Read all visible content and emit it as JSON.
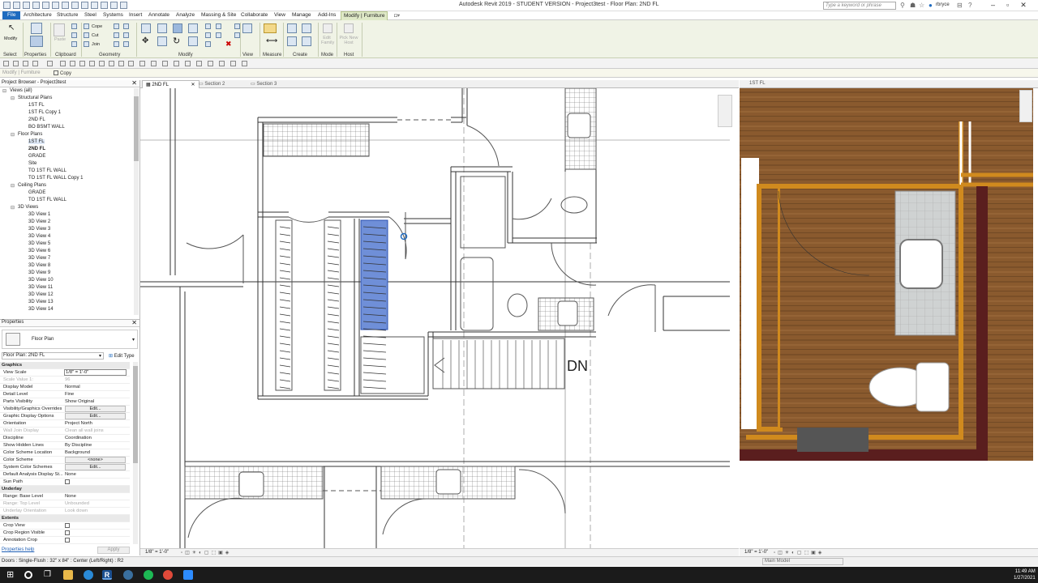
{
  "window": {
    "title": "Autodesk Revit 2019 - STUDENT VERSION - Project3test - Floor Plan: 2ND FL",
    "search_placeholder": "Type a keyword or phrase",
    "user": "rbryce"
  },
  "menu": {
    "tabs": [
      "File",
      "Architecture",
      "Structure",
      "Steel",
      "Systems",
      "Insert",
      "Annotate",
      "Analyze",
      "Massing & Site",
      "Collaborate",
      "View",
      "Manage",
      "Add-Ins",
      "Modify | Furniture"
    ]
  },
  "ribbon": {
    "modify": "Modify",
    "properties": "Properties",
    "paste": "Paste",
    "cope": "Cope",
    "cut": "Cut",
    "join": "Join",
    "edit_family": "Edit Family",
    "pick_new_host": "Pick New Host",
    "panels": [
      "Select",
      "Properties",
      "Clipboard",
      "Geometry",
      "Modify",
      "View",
      "Measure",
      "Create",
      "Mode",
      "Host"
    ]
  },
  "context": {
    "label": "Modify | Furniture",
    "copy_label": "Copy"
  },
  "project_browser": {
    "title": "Project Browser - Project3test",
    "tree": [
      {
        "t": "Views (all)",
        "lvl": 0,
        "tog": "−"
      },
      {
        "t": "Structural Plans",
        "lvl": 1,
        "tog": "−"
      },
      {
        "t": "1ST FL",
        "lvl": 2
      },
      {
        "t": "1ST FL Copy 1",
        "lvl": 2
      },
      {
        "t": "2ND FL",
        "lvl": 2
      },
      {
        "t": "BO BSMT WALL",
        "lvl": 2
      },
      {
        "t": "Floor Plans",
        "lvl": 1,
        "tog": "−"
      },
      {
        "t": "1ST FL",
        "lvl": 2,
        "sel": true
      },
      {
        "t": "2ND FL",
        "lvl": 2,
        "bold": true
      },
      {
        "t": "GRADE",
        "lvl": 2
      },
      {
        "t": "Site",
        "lvl": 2
      },
      {
        "t": "TO 1ST FL WALL",
        "lvl": 2
      },
      {
        "t": "TO 1ST FL WALL Copy 1",
        "lvl": 2
      },
      {
        "t": "Ceiling Plans",
        "lvl": 1,
        "tog": "−"
      },
      {
        "t": "GRADE",
        "lvl": 2
      },
      {
        "t": "TO 1ST FL WALL",
        "lvl": 2
      },
      {
        "t": "3D Views",
        "lvl": 1,
        "tog": "−"
      },
      {
        "t": "3D View 1",
        "lvl": 2
      },
      {
        "t": "3D View 2",
        "lvl": 2
      },
      {
        "t": "3D View 3",
        "lvl": 2
      },
      {
        "t": "3D View 4",
        "lvl": 2
      },
      {
        "t": "3D View 5",
        "lvl": 2
      },
      {
        "t": "3D View 6",
        "lvl": 2
      },
      {
        "t": "3D View 7",
        "lvl": 2
      },
      {
        "t": "3D View 8",
        "lvl": 2
      },
      {
        "t": "3D View 9",
        "lvl": 2
      },
      {
        "t": "3D View 10",
        "lvl": 2
      },
      {
        "t": "3D View 11",
        "lvl": 2
      },
      {
        "t": "3D View 12",
        "lvl": 2
      },
      {
        "t": "3D View 13",
        "lvl": 2
      },
      {
        "t": "3D View 14",
        "lvl": 2
      }
    ]
  },
  "properties": {
    "title": "Properties",
    "type_name": "Floor Plan",
    "instance": "Floor Plan: 2ND FL",
    "edit_type": "Edit Type",
    "rows": [
      {
        "kind": "group",
        "n": "Graphics"
      },
      {
        "n": "View Scale",
        "v": "1/8\" = 1'-0\"",
        "input": true
      },
      {
        "n": "Scale Value    1:",
        "v": "96",
        "grey": true
      },
      {
        "n": "Display Model",
        "v": "Normal"
      },
      {
        "n": "Detail Level",
        "v": "Fine"
      },
      {
        "n": "Parts Visibility",
        "v": "Show Original"
      },
      {
        "n": "Visibility/Graphics Overrides",
        "v": "Edit...",
        "btn": true
      },
      {
        "n": "Graphic Display Options",
        "v": "Edit...",
        "btn": true
      },
      {
        "n": "Orientation",
        "v": "Project North"
      },
      {
        "n": "Wall Join Display",
        "v": "Clean all wall joins",
        "grey": true
      },
      {
        "n": "Discipline",
        "v": "Coordination"
      },
      {
        "n": "Show Hidden Lines",
        "v": "By Discipline"
      },
      {
        "n": "Color Scheme Location",
        "v": "Background"
      },
      {
        "n": "Color Scheme",
        "v": "<none>",
        "btn": true
      },
      {
        "n": "System Color Schemes",
        "v": "Edit...",
        "btn": true
      },
      {
        "n": "Default Analysis Display St...",
        "v": "None"
      },
      {
        "n": "Sun Path",
        "cb": true
      },
      {
        "kind": "group",
        "n": "Underlay"
      },
      {
        "n": "Range: Base Level",
        "v": "None"
      },
      {
        "n": "Range: Top Level",
        "v": "Unbounded",
        "grey": true
      },
      {
        "n": "Underlay Orientation",
        "v": "Look down",
        "grey": true
      },
      {
        "kind": "group",
        "n": "Extents"
      },
      {
        "n": "Crop View",
        "cb": true
      },
      {
        "n": "Crop Region Visible",
        "cb": true
      },
      {
        "n": "Annotation Crop",
        "cb": true
      }
    ],
    "help": "Properties help",
    "apply": "Apply"
  },
  "view_tabs": [
    "2ND FL",
    "Section 2",
    "Section 3"
  ],
  "view2_title": "1ST FL",
  "plan": {
    "dn_label": "DN"
  },
  "view1_scale": "1/8\" = 1'-0\"",
  "view2_scale": "1/8\" = 1'-0\"",
  "status": {
    "text": "Doors : Single-Flush : 32\" x 84\" : Center (Left/Right) : R2",
    "model": "Main Model"
  },
  "taskbar": {
    "time": "11:49 AM",
    "date": "1/27/2021"
  }
}
